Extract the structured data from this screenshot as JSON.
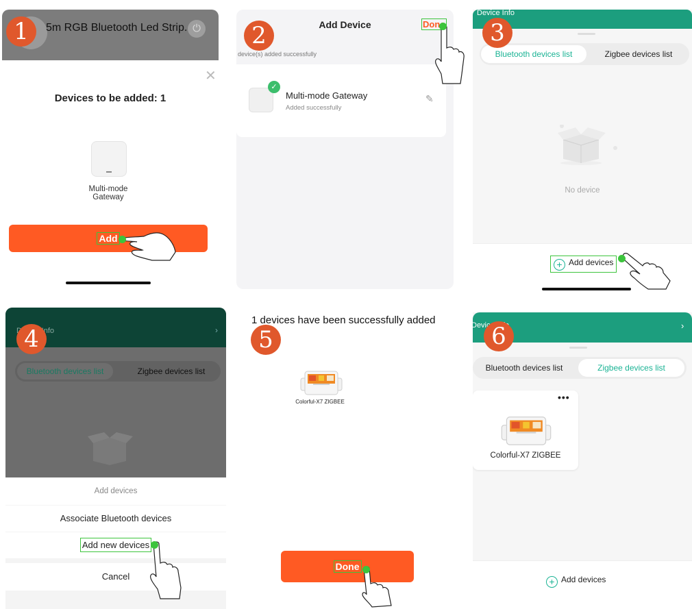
{
  "colors": {
    "accent_orange": "#ff5a23",
    "badge": "#e0582c",
    "teal": "#1c9e7e",
    "highlight_green": "#3cc43c"
  },
  "badges": [
    "1",
    "2",
    "3",
    "4",
    "5",
    "6"
  ],
  "step1": {
    "title": "5m RGB Bluetooth Led Strip...",
    "heading": "Devices to be added: 1",
    "device_name": "Multi-mode Gateway",
    "add_label": "Add",
    "icons": [
      "power-icon",
      "close-icon",
      "gateway-device-icon"
    ]
  },
  "step2": {
    "title": "Add Device",
    "done_label": "Done",
    "subtitle": "device(s) added successfully",
    "device_name": "Multi-mode Gateway",
    "device_status": "Added successfully",
    "icons": [
      "check-icon",
      "edit-icon"
    ]
  },
  "step3": {
    "header": "Device Info",
    "tab_bluetooth": "Bluetooth devices list",
    "tab_zigbee": "Zigbee devices list",
    "empty_text": "No device",
    "add_devices_label": "Add devices",
    "icons": [
      "empty-box-icon",
      "plus-circle-icon"
    ]
  },
  "step4": {
    "header": "Device Info",
    "tab_bluetooth": "Bluetooth devices list",
    "tab_zigbee": "Zigbee devices list",
    "sheet_title": "Add devices",
    "option_associate": "Associate Bluetooth devices",
    "option_add_new": "Add new devices",
    "cancel_label": "Cancel"
  },
  "step5": {
    "title": "1 devices have been successfully added",
    "device_name": "Colorful-X7 ZIGBEE",
    "done_label": "Done"
  },
  "step6": {
    "header": "Device Info",
    "tab_bluetooth": "Bluetooth devices list",
    "tab_zigbee": "Zigbee devices list",
    "more_label": "•••",
    "device_name": "Colorful-X7 ZIGBEE",
    "add_devices_label": "Add devices"
  }
}
